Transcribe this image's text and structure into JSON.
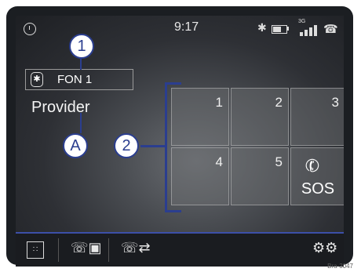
{
  "status": {
    "time": "9:17",
    "network": "3G"
  },
  "phone": {
    "device_label": "FON 1",
    "provider": "Provider"
  },
  "keys": [
    {
      "label": "1"
    },
    {
      "label": "2"
    },
    {
      "label": "3"
    },
    {
      "label": "4"
    },
    {
      "label": "5"
    },
    {
      "label": "SOS"
    }
  ],
  "callouts": {
    "one": "1",
    "two": "2",
    "a": "A"
  },
  "image_code": "Bra-3047",
  "colors": {
    "callout": "#2b3e8f",
    "menu_accent": "#3c4fa8"
  }
}
